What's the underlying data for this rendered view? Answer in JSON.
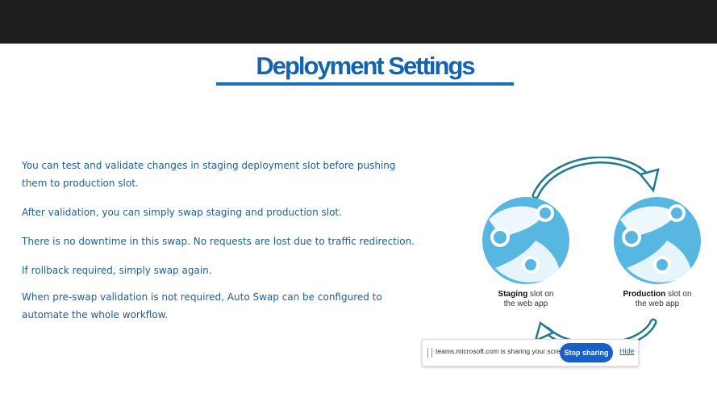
{
  "slide": {
    "title": "Deployment Settings",
    "paragraphs": [
      "You can test and validate changes in staging deployment slot before pushing them to production slot.",
      "After validation, you can simply swap staging and production slot.",
      "There is no downtime in this swap. No requests are lost due to traffic redirection.",
      "If rollback required, simply swap again.",
      "When pre-swap validation is not required, Auto Swap can be configured to automate the whole workflow."
    ]
  },
  "diagram": {
    "staging": {
      "bold": "Staging",
      "rest1": " slot on",
      "line2": "the web app"
    },
    "production": {
      "bold": "Production",
      "rest1": " slot on",
      "line2": "the web app"
    },
    "colors": {
      "circle": "#58b7e0",
      "arrow": "#1f7a8c"
    }
  },
  "share_bar": {
    "message": "teams.microsoft.com is sharing your screen.",
    "stop_label": "Stop sharing",
    "hide_label": "Hide"
  }
}
